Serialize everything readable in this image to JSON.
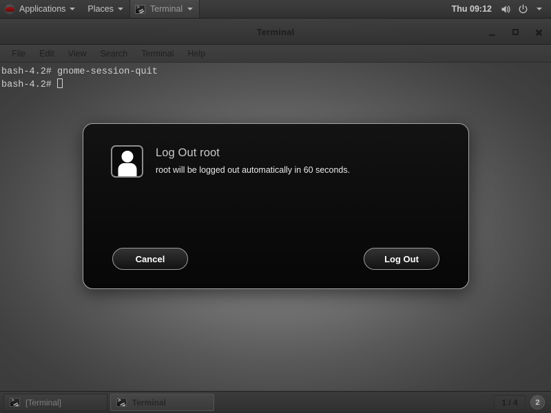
{
  "top_panel": {
    "applications_label": "Applications",
    "places_label": "Places",
    "window_entry_label": "Terminal",
    "clock": "Thu 09:12",
    "icons": {
      "logo": "redhat-logo-icon",
      "volume": "volume-icon",
      "power": "power-icon",
      "dropdown": "chevron-down-icon"
    }
  },
  "terminal_window": {
    "title": "Terminal",
    "menus": [
      "File",
      "Edit",
      "View",
      "Search",
      "Terminal",
      "Help"
    ],
    "window_buttons": {
      "minimize": "minimize-icon",
      "maximize": "maximize-icon",
      "close": "close-icon"
    },
    "lines": [
      "bash-4.2# gnome-session-quit",
      "bash-4.2# "
    ]
  },
  "logout_dialog": {
    "title": "Log Out root",
    "message": "root will be logged out automatically in 60 seconds.",
    "avatar_icon": "user-avatar-icon",
    "cancel_label": "Cancel",
    "confirm_label": "Log Out"
  },
  "bottom_panel": {
    "tasks": [
      {
        "label": "[Terminal]",
        "active": false
      },
      {
        "label": "Terminal",
        "active": true
      }
    ],
    "workspace_count": "1 / 4",
    "workspace_next": "2"
  },
  "colors": {
    "panel_bg": "#383838",
    "dialog_bg": "#0e0e0e",
    "dialog_border": "#a8a8a8",
    "accent_logo": "#8c1111",
    "text_light": "#cfcfcf"
  }
}
